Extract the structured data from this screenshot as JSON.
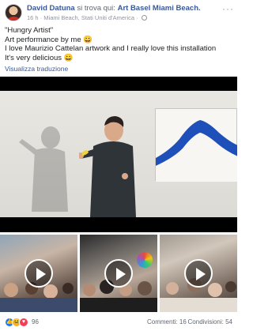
{
  "header": {
    "author": "David Datuna",
    "verb": "si trova qui:",
    "place": "Art Basel Miami Beach.",
    "time": "16 h",
    "separator": "·",
    "location": "Miami Beach, Stati Uniti d'America",
    "separator2": "·",
    "more_label": "···"
  },
  "post": {
    "lines": [
      "\"Hungry Artist\"",
      "Art performance by me 😀",
      "I love Maurizio Cattelan artwork and I really love this installation",
      "It's very delicious 😀"
    ],
    "translate_label": "Visualizza traduzione"
  },
  "media": {
    "main_alt": "video",
    "thumbnails": 3
  },
  "footer": {
    "reaction_icons": [
      "like-icon",
      "haha-icon",
      "love-icon"
    ],
    "reaction_count": "96",
    "comments": "Commenti: 16",
    "shares": "Condivisioni: 54"
  },
  "colors": {
    "link": "#385898",
    "meta": "#90949c",
    "like": "#1877f2",
    "haha": "#f7b125",
    "love": "#f33e58"
  }
}
